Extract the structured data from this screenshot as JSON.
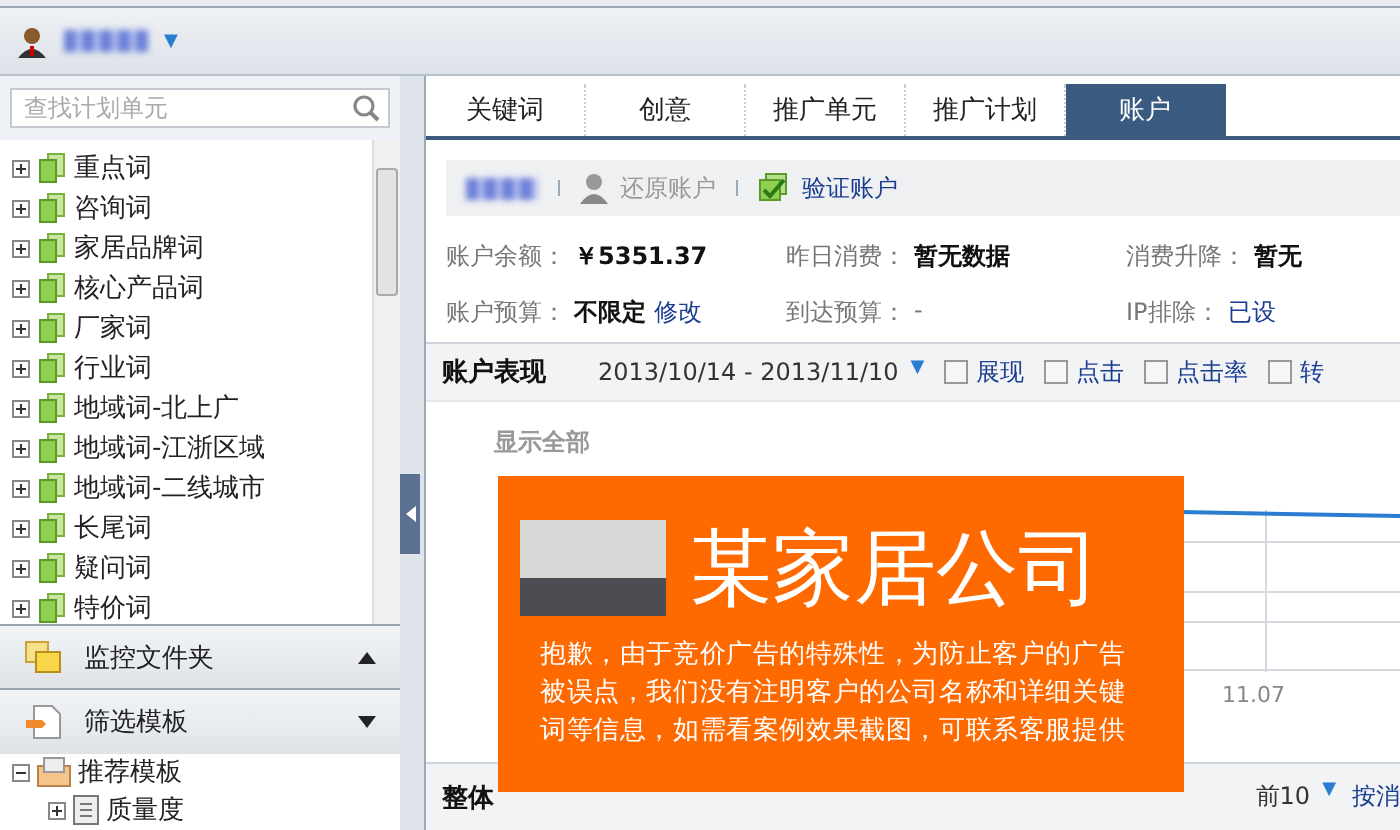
{
  "user_bar": {
    "menu_caret": "▼"
  },
  "search": {
    "placeholder": "查找计划单元"
  },
  "plan_tree": [
    {
      "label": "重点词",
      "expanded": false
    },
    {
      "label": "咨询词",
      "expanded": false
    },
    {
      "label": "家居品牌词",
      "expanded": false
    },
    {
      "label": "核心产品词",
      "expanded": false
    },
    {
      "label": "厂家词",
      "expanded": false
    },
    {
      "label": "行业词",
      "expanded": false
    },
    {
      "label": "地域词-北上广",
      "expanded": false
    },
    {
      "label": "地域词-江浙区域",
      "expanded": false
    },
    {
      "label": "地域词-二线城市",
      "expanded": false
    },
    {
      "label": "长尾词",
      "expanded": false
    },
    {
      "label": "疑问词",
      "expanded": false
    },
    {
      "label": "特价词",
      "expanded": false
    }
  ],
  "panels": [
    {
      "kind": "folder",
      "label": "监控文件夹",
      "expanded": true
    },
    {
      "kind": "template",
      "label": "筛选模板",
      "expanded": false
    }
  ],
  "template_tree": [
    {
      "label": "推荐模板",
      "expanded": true,
      "children": [
        {
          "label": "质量度",
          "expanded": false
        }
      ]
    }
  ],
  "tabs": [
    {
      "label": "关键词",
      "selected": false
    },
    {
      "label": "创意",
      "selected": false
    },
    {
      "label": "推广单元",
      "selected": false
    },
    {
      "label": "推广计划",
      "selected": false
    },
    {
      "label": "账户",
      "selected": true
    }
  ],
  "toolbar": [
    {
      "label": "还原账户",
      "disabled": true,
      "kind": "restore"
    },
    {
      "label": "验证账户",
      "disabled": false,
      "kind": "verify"
    }
  ],
  "info": [
    [
      {
        "label": "账户余额：",
        "value": "￥5351.37"
      },
      {
        "label": "昨日消费：",
        "value": "暂无数据"
      },
      {
        "label": "消费升降：",
        "value": "暂无"
      }
    ],
    [
      {
        "label": "账户预算：",
        "value": "不限定",
        "link": "修改"
      },
      {
        "label": "到达预算：",
        "value": "-",
        "muted": true
      },
      {
        "label": "IP排除：",
        "link": "已设"
      }
    ]
  ],
  "performance": {
    "title": "账户表现",
    "date_range": "2013/10/14 - 2013/11/10",
    "metrics": [
      {
        "label": "展现",
        "checked": false
      },
      {
        "label": "点击",
        "checked": false
      },
      {
        "label": "点击率",
        "checked": false
      },
      {
        "label": "转",
        "checked": false
      }
    ]
  },
  "chart": {
    "show_all": "显示全部",
    "x_label": "11.07"
  },
  "ranking": {
    "title": "整体",
    "top": "前10",
    "sort": "按消"
  },
  "notice": {
    "title": "某家居公司",
    "text": "抱歉，由于竞价广告的特殊性，为防止客户的广告被误点，我们没有注明客户的公司名称和详细关键词等信息，如需看案例效果截图，可联系客服提供"
  }
}
